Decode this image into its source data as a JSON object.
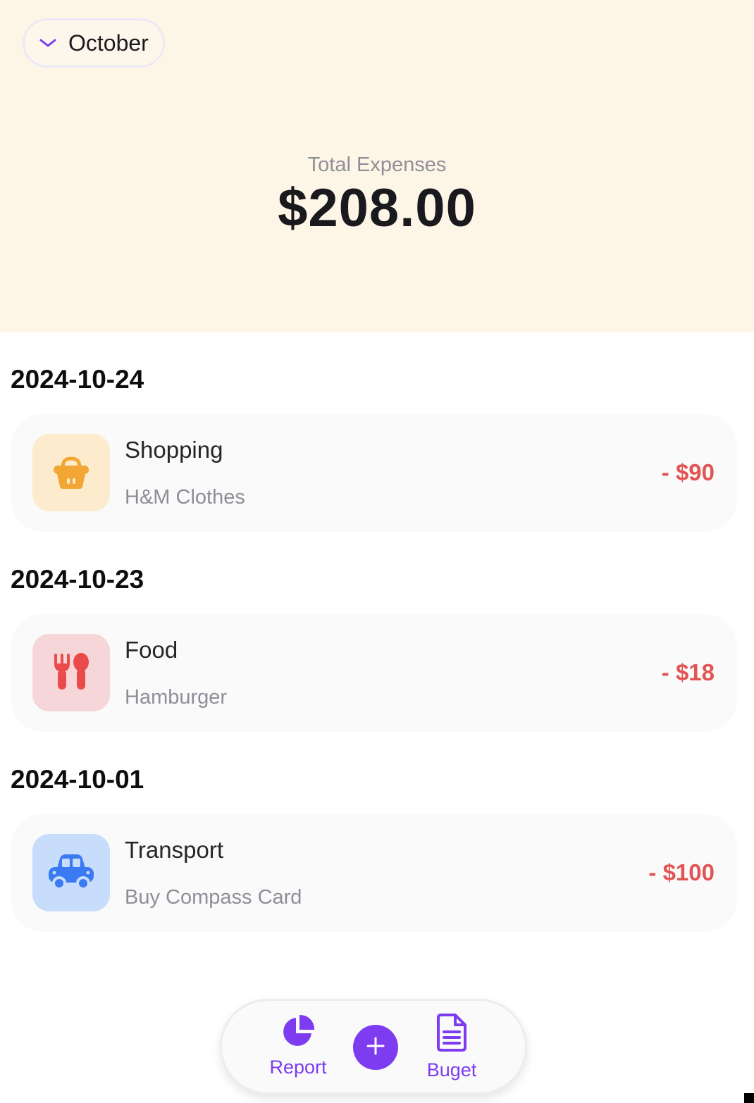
{
  "header": {
    "month": "October",
    "total_label": "Total Expenses",
    "total_value": "$208.00"
  },
  "groups": [
    {
      "date": "2024-10-24",
      "category": "Shopping",
      "note": "H&M Clothes",
      "amount": "- $90",
      "icon": "basket-icon",
      "icon_bg": "#fcebcc",
      "icon_color": "#f2a634"
    },
    {
      "date": "2024-10-23",
      "category": "Food",
      "note": "Hamburger",
      "amount": "- $18",
      "icon": "fork-spoon-icon",
      "icon_bg": "#f6d6d8",
      "icon_color": "#ea4a4a"
    },
    {
      "date": "2024-10-01",
      "category": "Transport",
      "note": "Buy Compass Card",
      "amount": "- $100",
      "icon": "car-icon",
      "icon_bg": "#c7ddfb",
      "icon_color": "#3a7af2"
    }
  ],
  "nav": {
    "report_label": "Report",
    "budget_label": "Buget",
    "accent": "#7d3cf0"
  },
  "colors": {
    "header_bg": "#fdf5e6",
    "expense_red": "#e25454"
  }
}
